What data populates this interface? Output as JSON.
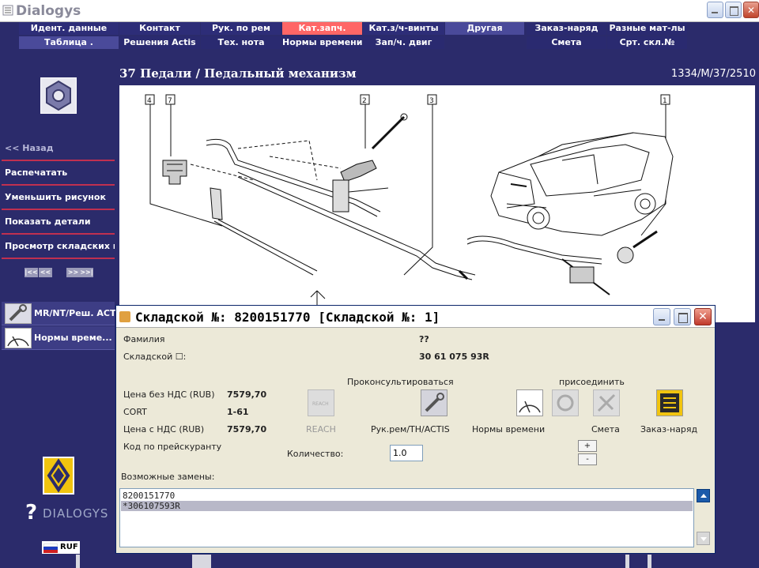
{
  "app": {
    "title": "Dialogys"
  },
  "nav": {
    "row1": [
      "Идент. данные",
      "Контакт",
      "Рук. по рем",
      "Кат.запч.",
      "Кат.з/ч-винты",
      "Другая",
      "Заказ-наряд",
      "Разные мат-лы"
    ],
    "row2": [
      "Таблица .",
      "Решения Actis",
      "Тех. нота",
      "Нормы времени",
      "Зап/ч. двиг",
      "",
      "Смета",
      "Срт. скл.№"
    ],
    "active": "Кат.запч."
  },
  "sidebar": {
    "items": [
      "<< Назад",
      "Распечатать",
      "Уменьшить рисунок",
      "Показать детали",
      "Просмотр складских но..."
    ],
    "pager": [
      "|<<",
      "<<",
      ">>",
      ">>|"
    ],
    "shortcuts": [
      "MR/NT/Реш. ACTIS",
      "Нормы време..."
    ],
    "brand": "DIALOGYS",
    "language": "RUF"
  },
  "header": {
    "title": "37 Педали / Педальный механизм",
    "code": "1334/M/37/2510"
  },
  "drawing": {
    "callouts": [
      "4",
      "7",
      "2",
      "3",
      "1"
    ]
  },
  "dialog": {
    "title": "Складской №: 8200151770 [Складской №: 1]",
    "fields": [
      {
        "label": "Фамилия",
        "value": "??"
      },
      {
        "label": "Складской ☐:",
        "value": "30 61 075 93R"
      }
    ],
    "prices": [
      {
        "label": "Цена без НДС (RUB)",
        "value": "7579,70"
      },
      {
        "label": "CORT",
        "value": "1-61"
      },
      {
        "label": "Цена с НДС (RUB)",
        "value": "7579,70"
      }
    ],
    "price_list_code_label": "Код по прейскуранту",
    "consult_label": "Проконсультироваться",
    "attach_label": "присоединить",
    "actions": {
      "reach": "REACH",
      "manual": "Рук.рем/TH/ACTIS",
      "labour": "Нормы времени",
      "estimate": "Смета",
      "order": "Заказ-наряд"
    },
    "quantity_label": "Количество:",
    "quantity_value": "1.0",
    "plus": "+",
    "minus": "-",
    "substitutes_label": "Возможные замены:",
    "substitutes": [
      "8200151770",
      "*306107593R"
    ]
  },
  "colors": {
    "background": "#2b2b6b",
    "active_tab": "#ff6666",
    "separator": "#c03050"
  }
}
